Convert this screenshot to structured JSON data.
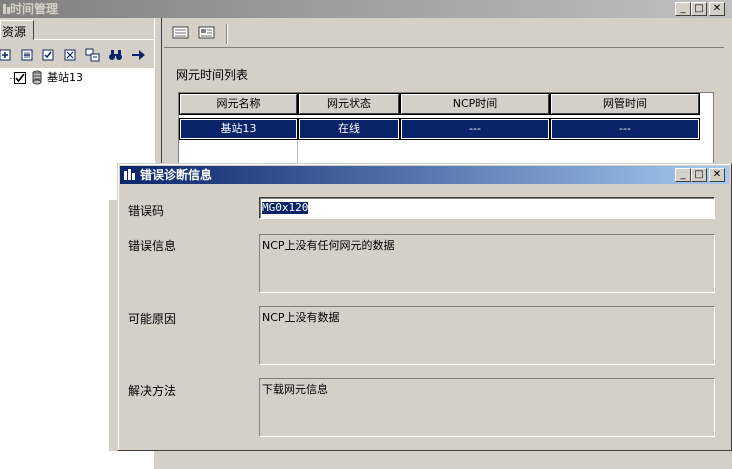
{
  "outer_window": {
    "title": "时间管理"
  },
  "left_pane": {
    "tab_label": "资源",
    "tree": {
      "node_label": "基站13",
      "checked": true
    }
  },
  "main": {
    "list_title": "网元时间列表",
    "columns": [
      "网元名称",
      "网元状态",
      "NCP时间",
      "网管时间"
    ],
    "rows": [
      {
        "name": "基站13",
        "status": "在线",
        "ncp_time": "---",
        "nms_time": "---"
      }
    ]
  },
  "dialog": {
    "title": "错误诊断信息",
    "error_code_label": "错误码",
    "error_code_value": "MG0x120",
    "error_info_label": "错误信息",
    "error_info_value": "NCP上没有任何网元的数据",
    "possible_cause_label": "可能原因",
    "possible_cause_value": "NCP上没有数据",
    "solution_label": "解决方法",
    "solution_value": "下载网元信息"
  },
  "colors": {
    "title_active_start": "#0a246a",
    "title_active_end": "#a6caf0",
    "title_inactive": "#808080",
    "selection": "#0a246a"
  },
  "icons": [
    "app-icon",
    "expand-all-icon",
    "collapse-all-icon",
    "check-all-icon",
    "uncheck-all-icon",
    "refresh-icon",
    "find-icon",
    "go-icon",
    "toolbar-icon-1",
    "toolbar-icon-2",
    "database-icon"
  ]
}
